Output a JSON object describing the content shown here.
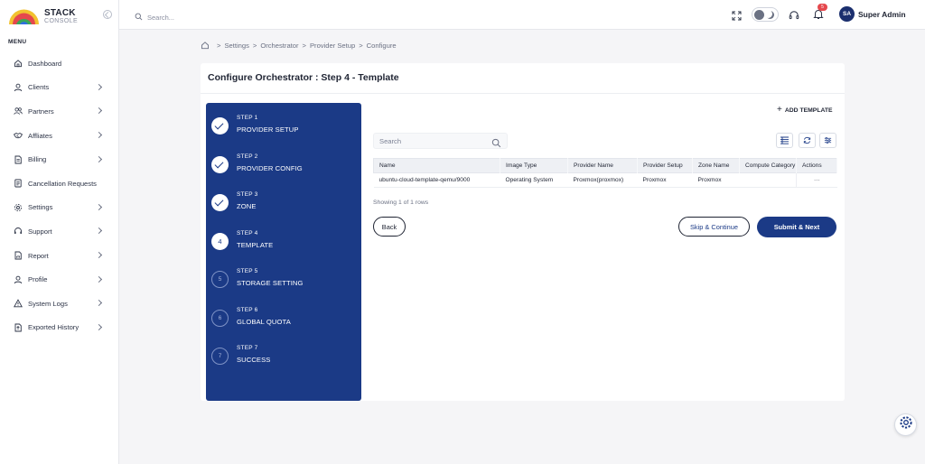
{
  "brand": {
    "name": "STACK",
    "sub": "CONSOLE"
  },
  "colors": {
    "primary": "#1b3a86",
    "badge": "#e5484d",
    "text": "#1f2433"
  },
  "sidebar": {
    "menu_title": "MENU",
    "items": [
      {
        "label": "Dashboard",
        "icon": "home-icon",
        "has_children": false
      },
      {
        "label": "Clients",
        "icon": "user-icon",
        "has_children": true
      },
      {
        "label": "Partners",
        "icon": "users-icon",
        "has_children": true
      },
      {
        "label": "Affliates",
        "icon": "handshake-icon",
        "has_children": true
      },
      {
        "label": "Billing",
        "icon": "invoice-icon",
        "has_children": true
      },
      {
        "label": "Cancellation Requests",
        "icon": "document-icon",
        "has_children": false
      },
      {
        "label": "Settings",
        "icon": "gear-icon",
        "has_children": true
      },
      {
        "label": "Support",
        "icon": "headset-icon",
        "has_children": true
      },
      {
        "label": "Report",
        "icon": "report-icon",
        "has_children": true
      },
      {
        "label": "Profile",
        "icon": "profile-icon",
        "has_children": true
      },
      {
        "label": "System Logs",
        "icon": "warning-icon",
        "has_children": true
      },
      {
        "label": "Exported History",
        "icon": "export-icon",
        "has_children": true
      }
    ]
  },
  "topbar": {
    "search_placeholder": "Search...",
    "notification_count": "5",
    "user_initials": "SA",
    "user_name": "Super Admin"
  },
  "breadcrumb": [
    "Settings",
    "Orchestrator",
    "Provider Setup",
    "Configure"
  ],
  "page": {
    "title": "Configure Orchestrator : Step 4 - Template",
    "add_template_label": "ADD TEMPLATE",
    "table_search_placeholder": "Search",
    "showing_text": "Showing 1 of 1 rows",
    "buttons": {
      "back": "Back",
      "skip": "Skip & Continue",
      "submit": "Submit & Next"
    }
  },
  "steps": [
    {
      "label": "STEP 1",
      "name": "PROVIDER SETUP",
      "num": "1",
      "state": "done"
    },
    {
      "label": "STEP 2",
      "name": "PROVIDER CONFIG",
      "num": "2",
      "state": "done"
    },
    {
      "label": "STEP 3",
      "name": "ZONE",
      "num": "3",
      "state": "done"
    },
    {
      "label": "STEP 4",
      "name": "TEMPLATE",
      "num": "4",
      "state": "current"
    },
    {
      "label": "STEP 5",
      "name": "STORAGE SETTING",
      "num": "5",
      "state": "pending"
    },
    {
      "label": "STEP 6",
      "name": "GLOBAL QUOTA",
      "num": "6",
      "state": "pending"
    },
    {
      "label": "STEP 7",
      "name": "SUCCESS",
      "num": "7",
      "state": "pending"
    }
  ],
  "table": {
    "columns": [
      "Name",
      "Image Type",
      "Provider Name",
      "Provider Setup",
      "Zone Name",
      "Compute Category",
      "Actions"
    ],
    "rows": [
      [
        "ubuntu-cloud-template-qemu/9000",
        "Operating System",
        "Proxmox(proxmox)",
        "Proxmox",
        "Proxmox",
        "",
        "···"
      ]
    ]
  }
}
